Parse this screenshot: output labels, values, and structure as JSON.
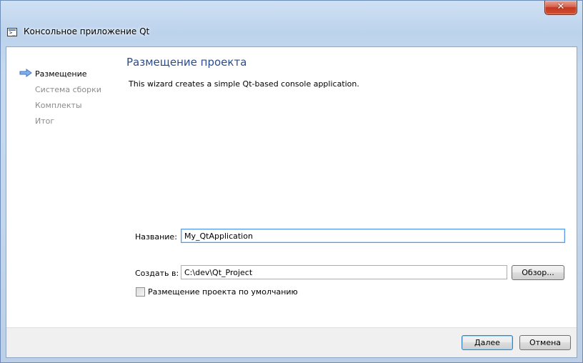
{
  "window": {
    "title": "Консольное приложение Qt",
    "close_glyph": "✕"
  },
  "sidebar": {
    "steps": [
      {
        "label": "Размещение",
        "active": true
      },
      {
        "label": "Система сборки",
        "active": false
      },
      {
        "label": "Комплекты",
        "active": false
      },
      {
        "label": "Итог",
        "active": false
      }
    ],
    "current_step_icon": "arrow-right-icon"
  },
  "page": {
    "title": "Размещение проекта",
    "description": "This wizard creates a simple Qt-based console application."
  },
  "form": {
    "name_label": "Название:",
    "name_value": "My_QtApplication",
    "create_in_label": "Создать в:",
    "create_in_value": "C:\\dev\\Qt_Project",
    "browse_label": "Обзор...",
    "default_location_label": "Размещение проекта по умолчанию",
    "default_location_checked": false
  },
  "footer": {
    "next_label": "Далее",
    "cancel_label": "Отмена"
  },
  "colors": {
    "title_color": "#2a4c8a",
    "inactive_step_color": "#8c8c8c",
    "arrow_color": "#4a86d8"
  }
}
